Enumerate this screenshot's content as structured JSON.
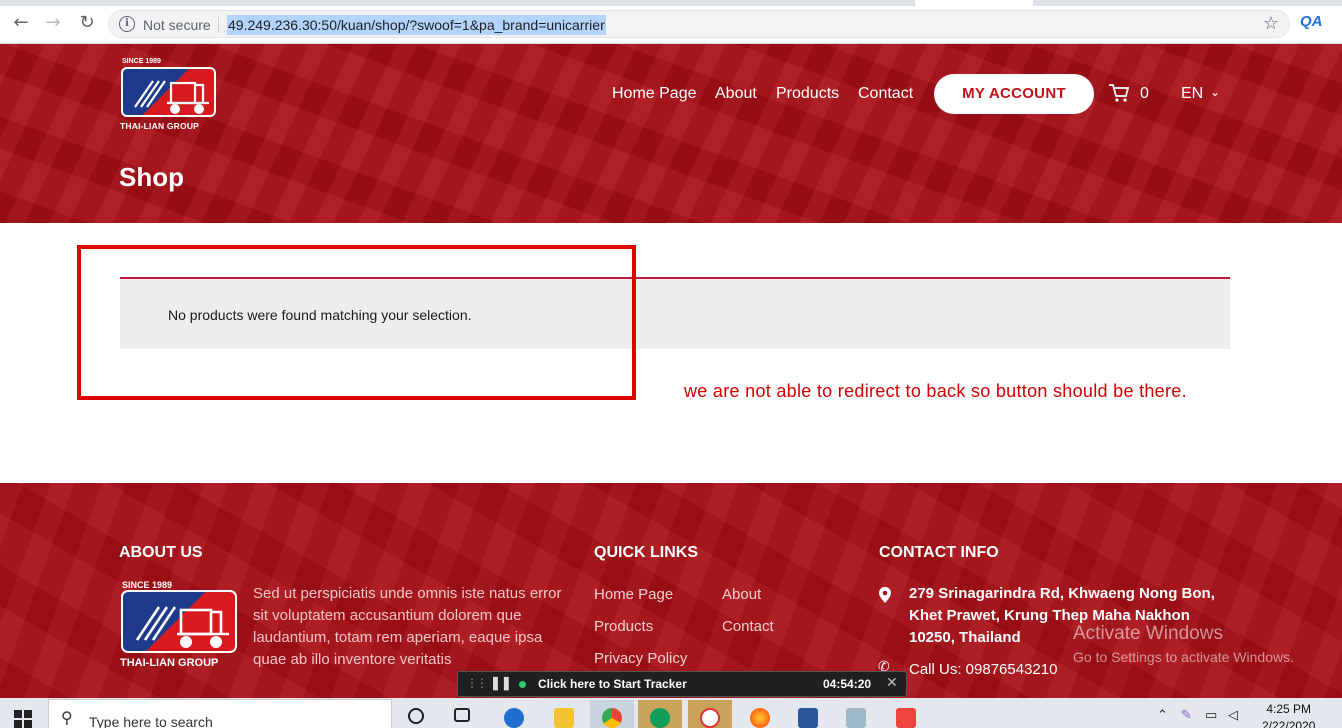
{
  "browser": {
    "security_label": "Not secure",
    "url": "49.249.236.30:50/kuan/shop/?swoof=1&pa_brand=unicarrier",
    "extension_label": "QA"
  },
  "header": {
    "logo_since": "SINCE 1989",
    "logo_name": "THAI-LIAN GROUP",
    "nav": [
      "Home Page",
      "About",
      "Products",
      "Contact"
    ],
    "account_button": "MY ACCOUNT",
    "cart_count": "0",
    "language": "EN",
    "page_title": "Shop"
  },
  "main": {
    "no_products_message": "No products were found matching your selection.",
    "annotation": "we are not able to redirect to back so button should be there."
  },
  "footer": {
    "about_heading": "ABOUT US",
    "about_text": "Sed ut perspiciatis unde omnis iste natus error sit voluptatem accusantium dolorem que laudantium, totam rem aperiam, eaque ipsa quae ab illo inventore veritatis",
    "quick_links_heading": "QUICK LINKS",
    "quick_links": [
      "Home Page",
      "About",
      "Products",
      "Contact",
      "Privacy Policy"
    ],
    "contact_heading": "CONTACT INFO",
    "address": "279 Srinagarindra Rd, Khwaeng Nong Bon, Khet Prawet, Krung Thep Maha Nakhon 10250, Thailand",
    "phone": "Call Us: 09876543210"
  },
  "watermark": {
    "line1": "Activate Windows",
    "line2": "Go to Settings to activate Windows."
  },
  "tracker": {
    "label": "Click here to Start Tracker",
    "time": "04:54:20"
  },
  "taskbar": {
    "search_placeholder": "Type here to search",
    "time": "4:25 PM",
    "date": "2/22/2020"
  },
  "colors": {
    "brand_red": "#a80f16",
    "accent_red": "#c0121b",
    "annotation_red": "#d40000"
  }
}
